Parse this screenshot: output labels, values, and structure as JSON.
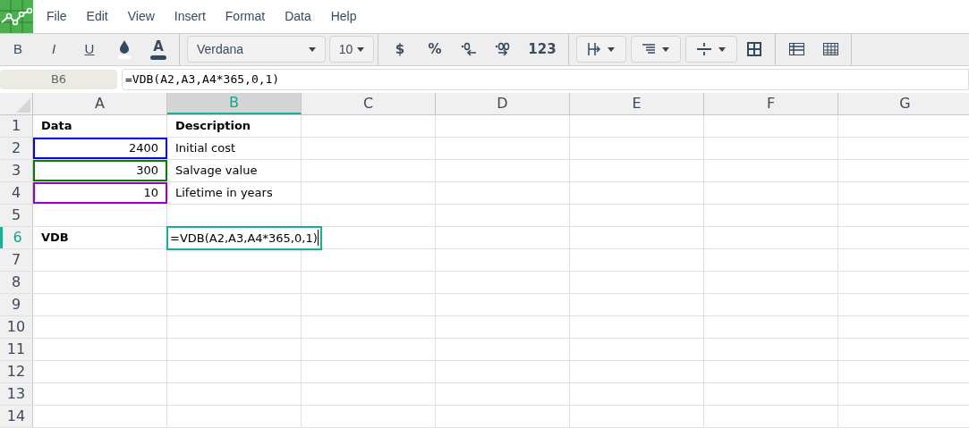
{
  "menu": [
    "File",
    "Edit",
    "View",
    "Insert",
    "Format",
    "Data",
    "Help"
  ],
  "toolbar": {
    "style_buttons": [
      {
        "kind": "bold",
        "label": "B"
      },
      {
        "kind": "italic",
        "label": "I"
      },
      {
        "kind": "underline",
        "label": "U"
      }
    ],
    "text_color_label": "A",
    "font": "Verdana",
    "size": "10",
    "currency": "$",
    "percent": "%",
    "number_format": "123"
  },
  "name_box": "B6",
  "formula": "=VDB(A2,A3,A4*365,0,1)",
  "columns": [
    {
      "label": "A",
      "selected": false
    },
    {
      "label": "B",
      "selected": true
    },
    {
      "label": "C",
      "selected": false
    },
    {
      "label": "D",
      "selected": false
    },
    {
      "label": "E",
      "selected": false
    },
    {
      "label": "F",
      "selected": false
    },
    {
      "label": "G",
      "selected": false
    }
  ],
  "rows": [
    {
      "label": "1",
      "selected": false,
      "cells": [
        {
          "text": "Data",
          "bold": true,
          "kind": "text"
        },
        {
          "text": "Description",
          "bold": true,
          "kind": "text"
        }
      ]
    },
    {
      "label": "2",
      "selected": false,
      "cells": [
        {
          "text": "2400",
          "bold": false,
          "kind": "number",
          "color": "#0000ff"
        },
        {
          "text": "Initial cost",
          "bold": false,
          "kind": "text"
        }
      ]
    },
    {
      "label": "3",
      "selected": false,
      "cells": [
        {
          "text": "300",
          "bold": false,
          "kind": "number",
          "color": "#008000"
        },
        {
          "text": "Salvage value",
          "bold": false,
          "kind": "text"
        }
      ]
    },
    {
      "label": "4",
      "selected": false,
      "cells": [
        {
          "text": "10",
          "bold": false,
          "kind": "number",
          "color": "#9900cc"
        },
        {
          "text": "Lifetime in years",
          "bold": false,
          "kind": "text"
        }
      ]
    },
    {
      "label": "5",
      "selected": false,
      "cells": []
    },
    {
      "label": "6",
      "selected": true,
      "cells": [
        {
          "text": "VDB",
          "bold": true,
          "kind": "text"
        },
        {
          "text": "=VDB(A2,A3,A4*365,0,1)",
          "bold": false,
          "kind": "editor"
        }
      ]
    },
    {
      "label": "7",
      "selected": false,
      "cells": []
    },
    {
      "label": "8",
      "selected": false,
      "cells": []
    },
    {
      "label": "9",
      "selected": false,
      "cells": []
    },
    {
      "label": "10",
      "selected": false,
      "cells": []
    },
    {
      "label": "11",
      "selected": false,
      "cells": []
    },
    {
      "label": "12",
      "selected": false,
      "cells": []
    },
    {
      "label": "13",
      "selected": false,
      "cells": []
    },
    {
      "label": "14",
      "selected": false,
      "cells": []
    }
  ]
}
